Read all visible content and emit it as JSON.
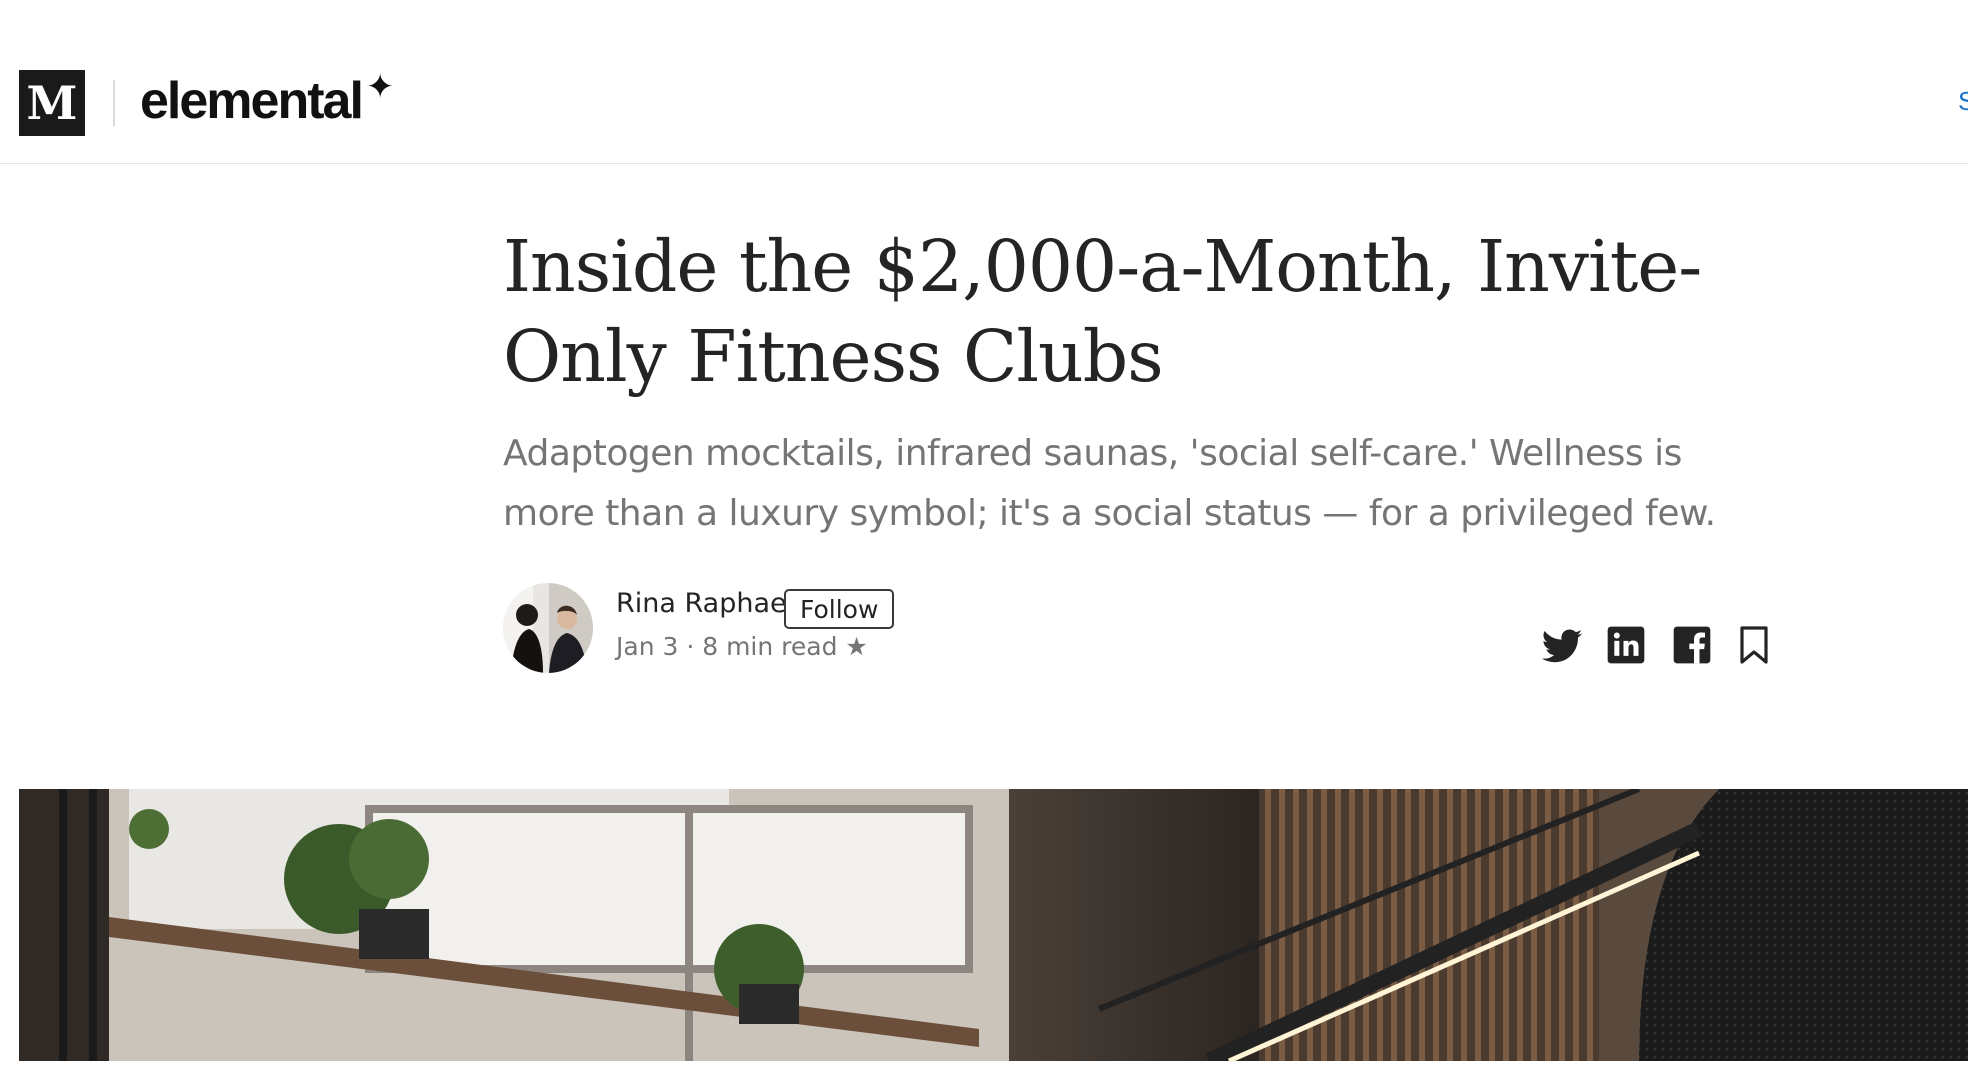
{
  "header": {
    "logo_letter": "M",
    "publication": "elemental",
    "publication_mark": "✦",
    "signin_partial": "S"
  },
  "article": {
    "title": "Inside the $2,000-a-Month, Invite-Only Fitness Clubs",
    "subtitle": "Adaptogen mocktails, infrared saunas, 'social self-care.' Wellness is more than a luxury symbol; it's a social status — for a privileged few."
  },
  "author": {
    "name": "Rina Raphael",
    "follow_label": "Follow",
    "meta": "Jan 3 · 8 min read ★"
  },
  "share": [
    "twitter-icon",
    "linkedin-icon",
    "facebook-icon",
    "bookmark-icon"
  ],
  "colors": {
    "link": "#1a73c9",
    "text": "#242424",
    "muted": "#757575"
  }
}
